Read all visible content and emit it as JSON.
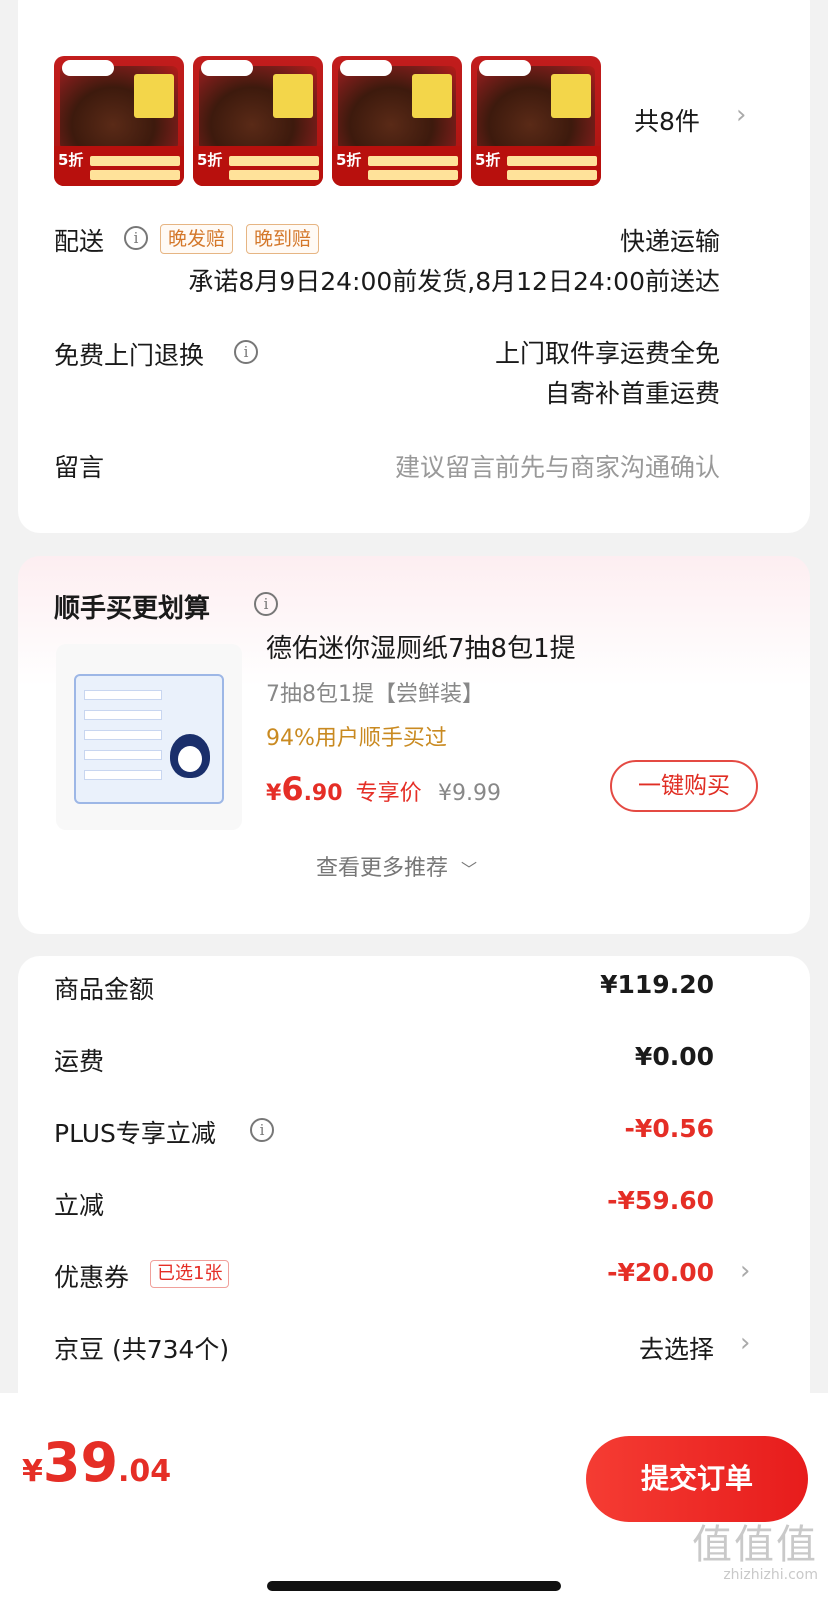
{
  "order": {
    "thumbnails": [
      {
        "discount": "5折"
      },
      {
        "discount": "5折"
      },
      {
        "discount": "5折"
      },
      {
        "discount": "5折"
      }
    ],
    "item_count": "共8件",
    "delivery": {
      "label": "配送",
      "tag_late_ship": "晚发赔",
      "tag_late_arrive": "晚到赔",
      "method": "快递运输",
      "promise": "承诺8月9日24:00前发货,8月12日24:00前送达"
    },
    "returns": {
      "label": "免费上门退换",
      "line1": "上门取件享运费全免",
      "line2": "自寄补首重运费"
    },
    "message": {
      "label": "留言",
      "placeholder": "建议留言前先与商家沟通确认"
    }
  },
  "addon": {
    "title": "顺手买更划算",
    "product": {
      "name": "德佑迷你湿厕纸7抽8包1提",
      "spec": "7抽8包1提【尝鲜装】",
      "social_proof": "94%用户顺手买过",
      "price_symbol": "¥",
      "price_int": "6",
      "price_dec": ".90",
      "price_label": "专享价",
      "original_price": "¥9.99",
      "buy_label": "一键购买"
    },
    "more_label": "查看更多推荐"
  },
  "pricing": {
    "rows": [
      {
        "label": "商品金额",
        "value": "¥119.20"
      },
      {
        "label": "运费",
        "value": "¥0.00"
      },
      {
        "label": "PLUS专享立减",
        "value": "-¥0.56"
      },
      {
        "label": "立减",
        "value": "-¥59.60"
      },
      {
        "label": "优惠券",
        "tag": "已选1张",
        "value": "-¥20.00"
      },
      {
        "label": "京豆 (共734个)",
        "value": "去选择"
      }
    ]
  },
  "footer": {
    "currency": "¥",
    "total_int": "39",
    "total_dec": ".04",
    "submit_label": "提交订单",
    "watermark": "值值值",
    "watermark_url": "zhizhizhi.com"
  },
  "colors": {
    "accent_red": "#e52e26",
    "tag_orange": "#d4782b",
    "gold_text": "#c98a21"
  }
}
